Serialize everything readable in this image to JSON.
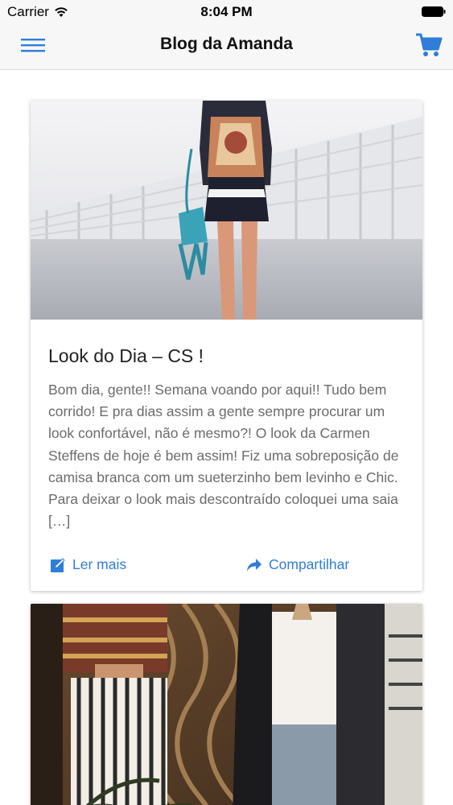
{
  "status_bar": {
    "carrier": "Carrier",
    "time": "8:04 PM"
  },
  "nav": {
    "title": "Blog da Amanda",
    "menu_icon": "hamburger-menu-icon",
    "cart_icon": "shopping-cart-icon"
  },
  "posts": [
    {
      "title": "Look do Dia – CS !",
      "excerpt": "Bom dia, gente!! Semana voando por aqui!! Tudo bem corrido! E pra dias assim a gente sempre procurar um look confortável, não é mesmo?! O look da Carmen Steffens de hoje é bem assim! Fiz uma sobreposição de camisa branca com um sueterzinho bem levinho e Chic. Para deixar o look mais descontraído coloquei uma saia […]",
      "read_more_label": "Ler mais",
      "share_label": "Compartilhar",
      "read_more_icon": "edit-icon",
      "share_icon": "share-arrow-icon"
    },
    {
      "title": "",
      "excerpt": ""
    }
  ],
  "colors": {
    "accent": "#2f7ed8",
    "bar_background": "#f7f7f7",
    "excerpt_text": "#6b6b6b"
  }
}
